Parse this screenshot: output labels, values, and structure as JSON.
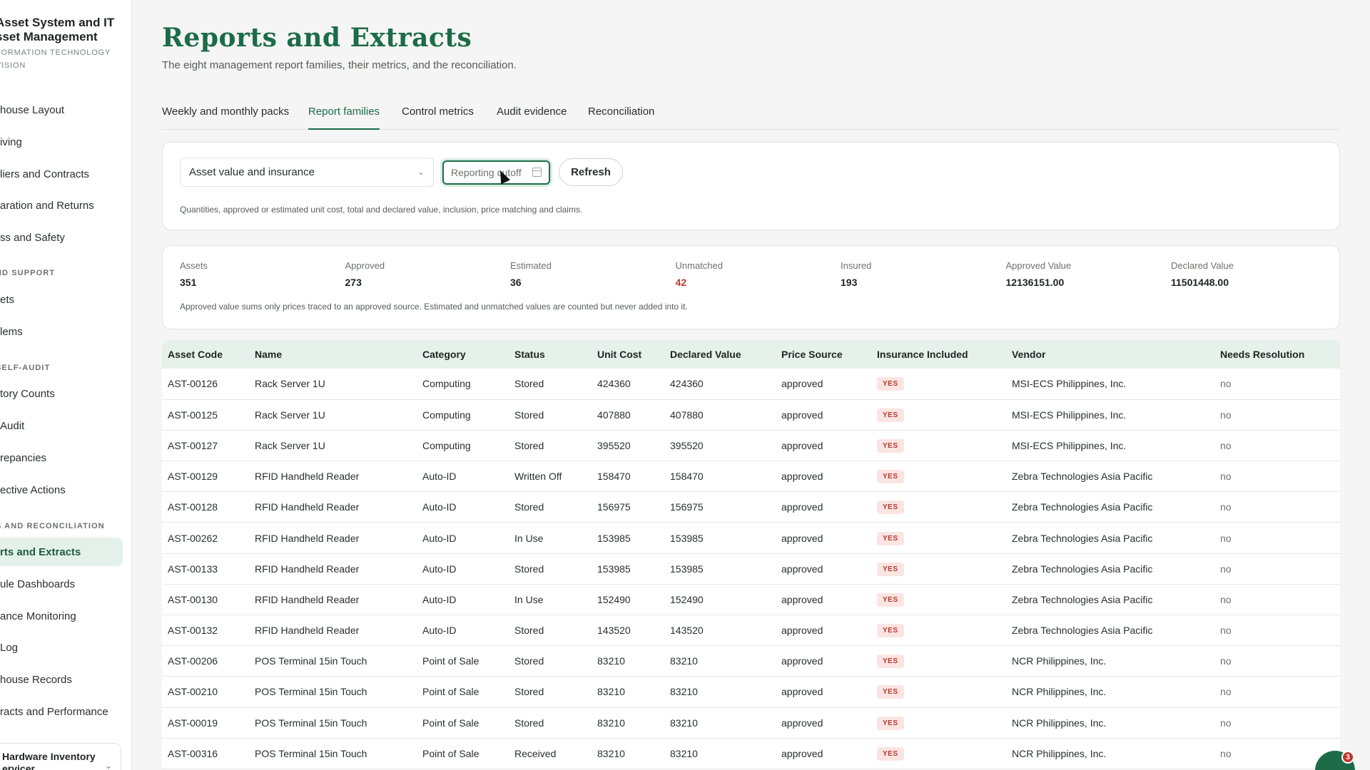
{
  "brand": {
    "title_line1": "Asset System and IT",
    "title_line2": "sset Management",
    "sub_line1": "FORMATION TECHNOLOGY",
    "sub_line2": "VISION"
  },
  "nav": {
    "items": [
      {
        "label": "house Layout",
        "active": false
      },
      {
        "label": "iving",
        "active": false
      },
      {
        "label": "liers and Contracts",
        "active": false
      },
      {
        "label": "aration and Returns",
        "active": false
      },
      {
        "label": "ss and Safety",
        "active": false
      },
      {
        "label": "ets",
        "active": false
      },
      {
        "label": "lems",
        "active": false
      },
      {
        "label": "tory Counts",
        "active": false
      },
      {
        "label": "Audit",
        "active": false
      },
      {
        "label": "repancies",
        "active": false
      },
      {
        "label": "ective Actions",
        "active": false
      },
      {
        "label": "rts and Extracts",
        "active": true
      },
      {
        "label": "ule Dashboards",
        "active": false
      },
      {
        "label": "ance Monitoring",
        "active": false
      },
      {
        "label": " Log",
        "active": false
      },
      {
        "label": "house Records",
        "active": false
      },
      {
        "label": "racts and Performance",
        "active": false
      }
    ],
    "sections": [
      "ND SUPPORT",
      "SELF-AUDIT",
      "S AND RECONCILIATION"
    ],
    "bottom_line1": "Hardware Inventory",
    "bottom_line2": "ervicer"
  },
  "page": {
    "title": "Reports and Extracts",
    "subtitle": "The eight management report families, their metrics, and the reconciliation."
  },
  "tabs": [
    {
      "label": "Weekly and monthly packs",
      "active": false
    },
    {
      "label": "Report families",
      "active": true
    },
    {
      "label": "Control metrics",
      "active": false
    },
    {
      "label": "Audit evidence",
      "active": false
    },
    {
      "label": "Reconciliation",
      "active": false
    }
  ],
  "filters": {
    "report_family": "Asset value and insurance",
    "cutoff_placeholder": "Reporting cutoff",
    "refresh_label": "Refresh",
    "note": "Quantities, approved or estimated unit cost, total and declared value, inclusion, price matching and claims."
  },
  "metrics": {
    "items": [
      {
        "label": "Assets",
        "value": "351"
      },
      {
        "label": "Approved",
        "value": "273"
      },
      {
        "label": "Estimated",
        "value": "36"
      },
      {
        "label": "Unmatched",
        "value": "42"
      },
      {
        "label": "Insured",
        "value": "193"
      },
      {
        "label": "Approved Value",
        "value": "12136151.00"
      },
      {
        "label": "Declared Value",
        "value": "11501448.00"
      }
    ],
    "note": "Approved value sums only prices traced to an approved source. Estimated and unmatched values are counted but never added into it."
  },
  "table": {
    "columns": [
      "Asset Code",
      "Name",
      "Category",
      "Status",
      "Unit Cost",
      "Declared Value",
      "Price Source",
      "Insurance Included",
      "Vendor",
      "Needs Resolution"
    ],
    "rows": [
      [
        "AST-00126",
        "Rack Server 1U",
        "Computing",
        "Stored",
        "424360",
        "424360",
        "approved",
        "YES",
        "MSI-ECS Philippines, Inc.",
        "no"
      ],
      [
        "AST-00125",
        "Rack Server 1U",
        "Computing",
        "Stored",
        "407880",
        "407880",
        "approved",
        "YES",
        "MSI-ECS Philippines, Inc.",
        "no"
      ],
      [
        "AST-00127",
        "Rack Server 1U",
        "Computing",
        "Stored",
        "395520",
        "395520",
        "approved",
        "YES",
        "MSI-ECS Philippines, Inc.",
        "no"
      ],
      [
        "AST-00129",
        "RFID Handheld Reader",
        "Auto-ID",
        "Written Off",
        "158470",
        "158470",
        "approved",
        "YES",
        "Zebra Technologies Asia Pacific",
        "no"
      ],
      [
        "AST-00128",
        "RFID Handheld Reader",
        "Auto-ID",
        "Stored",
        "156975",
        "156975",
        "approved",
        "YES",
        "Zebra Technologies Asia Pacific",
        "no"
      ],
      [
        "AST-00262",
        "RFID Handheld Reader",
        "Auto-ID",
        "In Use",
        "153985",
        "153985",
        "approved",
        "YES",
        "Zebra Technologies Asia Pacific",
        "no"
      ],
      [
        "AST-00133",
        "RFID Handheld Reader",
        "Auto-ID",
        "Stored",
        "153985",
        "153985",
        "approved",
        "YES",
        "Zebra Technologies Asia Pacific",
        "no"
      ],
      [
        "AST-00130",
        "RFID Handheld Reader",
        "Auto-ID",
        "In Use",
        "152490",
        "152490",
        "approved",
        "YES",
        "Zebra Technologies Asia Pacific",
        "no"
      ],
      [
        "AST-00132",
        "RFID Handheld Reader",
        "Auto-ID",
        "Stored",
        "143520",
        "143520",
        "approved",
        "YES",
        "Zebra Technologies Asia Pacific",
        "no"
      ],
      [
        "AST-00206",
        "POS Terminal 15in Touch",
        "Point of Sale",
        "Stored",
        "83210",
        "83210",
        "approved",
        "YES",
        "NCR Philippines, Inc.",
        "no"
      ],
      [
        "AST-00210",
        "POS Terminal 15in Touch",
        "Point of Sale",
        "Stored",
        "83210",
        "83210",
        "approved",
        "YES",
        "NCR Philippines, Inc.",
        "no"
      ],
      [
        "AST-00019",
        "POS Terminal 15in Touch",
        "Point of Sale",
        "Stored",
        "83210",
        "83210",
        "approved",
        "YES",
        "NCR Philippines, Inc.",
        "no"
      ],
      [
        "AST-00316",
        "POS Terminal 15in Touch",
        "Point of Sale",
        "Received",
        "83210",
        "83210",
        "approved",
        "YES",
        "NCR Philippines, Inc.",
        "no"
      ]
    ]
  },
  "chat": {
    "badge_count": "3"
  },
  "icons": {
    "select_chevron": "chevron-down-icon",
    "date_picker": "calendar-icon",
    "chat": "chat-bubble-icon"
  },
  "colors": {
    "accent": "#1d6b48",
    "active_nav_bg": "#e4f1ea",
    "header_bg": "#e6f1ec",
    "warn": "#c0392b",
    "badge_bg": "#fbe4e2"
  }
}
